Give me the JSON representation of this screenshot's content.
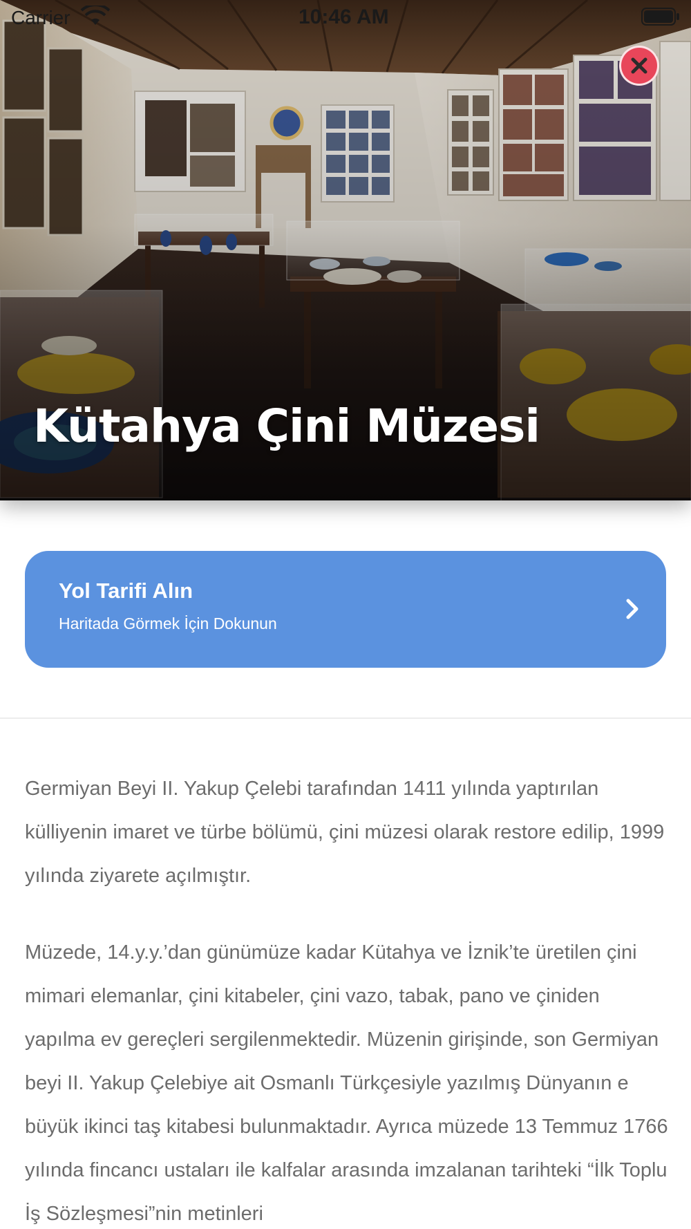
{
  "status_bar": {
    "carrier": "Carrier",
    "time": "10:46 AM"
  },
  "hero": {
    "title": "Kütahya Çini Müzesi",
    "close_icon": "close-icon"
  },
  "directions": {
    "title": "Yol Tarifi Alın",
    "subtitle": "Haritada Görmek İçin Dokunun",
    "icon": "chevron-right-icon",
    "background_color": "#5b92df"
  },
  "description": {
    "paragraphs": [
      "Germiyan Beyi II. Yakup Çelebi tarafından 1411 yılında yaptırılan külliyenin imaret ve türbe bölümü, çini müzesi olarak restore edilip, 1999 yılında ziyarete açılmıştır.",
      "Müzede, 14.y.y.’dan günümüze kadar Kütahya ve İznik’te üretilen çini mimari elemanlar, çini kitabeler, çini vazo, tabak, pano ve çiniden yapılma ev gereçleri sergilenmektedir. Müzenin girişinde, son Germiyan beyi II. Yakup Çelebiye ait Osmanlı Türkçesiyle yazılmış Dünyanın e büyük ikinci taş kitabesi bulunmaktadır. Ayrıca müzede 13 Temmuz 1766 yılında fincancı ustaları ile kalfalar arasında imzalanan tarihteki “İlk Toplu İş Sözleşmesi”nin metinleri"
    ]
  },
  "colors": {
    "close_button": "#e8465a",
    "body_text": "#6c6c6c",
    "divider": "#ececec"
  }
}
